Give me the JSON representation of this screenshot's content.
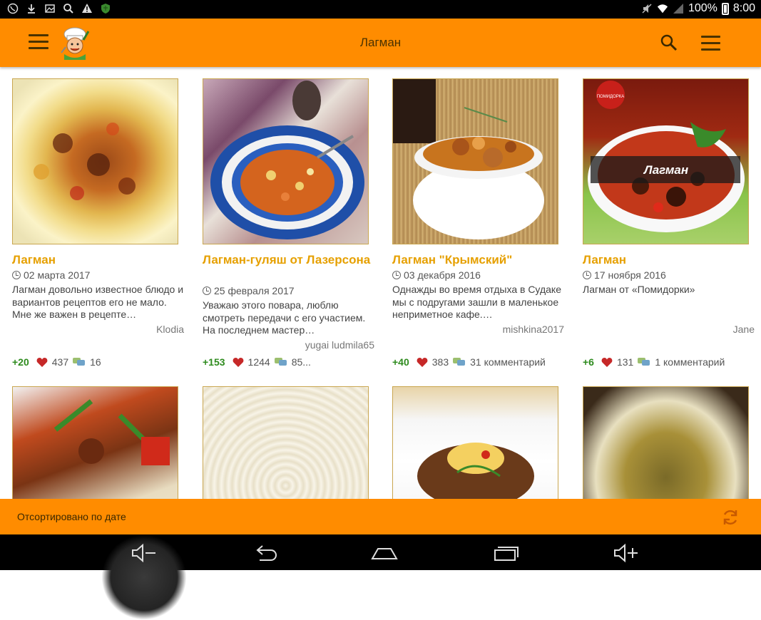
{
  "status_bar": {
    "battery": "100%",
    "time": "8:00",
    "icons": [
      "viber-icon",
      "download-icon",
      "image-icon",
      "search-icon",
      "warning-icon",
      "shield-icon",
      "mute-icon",
      "wifi-icon",
      "signal-icon",
      "battery-icon"
    ]
  },
  "app_bar": {
    "title": "Лагман",
    "icons": [
      "menu-icon",
      "chef-logo",
      "search-icon",
      "overflow-menu-icon"
    ]
  },
  "cards": [
    {
      "title": "Лагман",
      "date": "02 марта 2017",
      "description": "Лагман довольно известное блюдо и вариантов рецептов его не мало. Мне же важен в рецепте…",
      "author": "Klodia",
      "rating": "+20",
      "likes": "437",
      "comments": "16"
    },
    {
      "title": "Лагман-гуляш от Лазерсона",
      "date": "25 февраля 2017",
      "description": "Уважаю этого повара, люблю смотреть передачи с его участием. На последнем мастер…",
      "author": "yugai ludmila65",
      "rating": "+153",
      "likes": "1244",
      "comments": "85..."
    },
    {
      "title": "Лагман \"Крымский\"",
      "date": "03 декабря 2016",
      "description": "Однажды во время отдыха в Судаке мы с подругами зашли в маленькое неприметное кафе.…",
      "author": "mishkina2017",
      "rating": "+40",
      "likes": "383",
      "comments": "31 комментарий"
    },
    {
      "title": "Лагман",
      "date": "17 ноября 2016",
      "description": "Лагман от «Помидорки»",
      "author": "Jane",
      "rating": "+6",
      "likes": "131",
      "comments": "1 комментарий",
      "photo_overlay": "Лагман",
      "photo_badge": "ПОМИДОРКА"
    }
  ],
  "bottom_bar": {
    "sort_label": "Отсортировано по дате",
    "refresh_icon": "refresh-icon"
  },
  "nav_bar": {
    "icons": [
      "volume-down-icon",
      "back-icon",
      "home-icon",
      "recent-apps-icon",
      "volume-up-icon"
    ]
  },
  "colors": {
    "accent": "#ff8c00",
    "title": "#e6a000",
    "rating": "#2e8b1e",
    "heart": "#c62828"
  }
}
